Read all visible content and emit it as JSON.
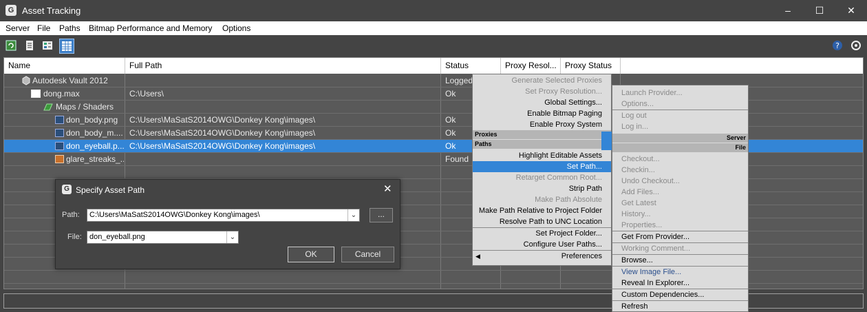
{
  "window": {
    "title": "Asset Tracking",
    "minimize": "–",
    "maximize": "☐",
    "close": "✕"
  },
  "menubar": [
    "Server",
    "File",
    "Paths",
    "Bitmap Performance and Memory",
    "Options"
  ],
  "toolbar": {
    "icons": [
      "refresh-icon",
      "list-view-icon",
      "detail-view-icon",
      "table-view-icon",
      "help-icon",
      "settings-icon"
    ]
  },
  "grid": {
    "headers": [
      "Name",
      "Full Path",
      "Status",
      "Proxy Resol...",
      "Proxy Status"
    ],
    "rows": [
      {
        "name": "Autodesk Vault 2012",
        "path": "",
        "status": "Logged"
      },
      {
        "name": "dong.max",
        "path": "C:\\Users\\",
        "status": "Ok"
      },
      {
        "name": "Maps / Shaders",
        "path": "",
        "status": ""
      },
      {
        "name": "don_body.png",
        "path": "C:\\Users\\MaSatS2014OWG\\Donkey Kong\\images\\",
        "status": "Ok"
      },
      {
        "name": "don_body_m....",
        "path": "C:\\Users\\MaSatS2014OWG\\Donkey Kong\\images\\",
        "status": "Ok"
      },
      {
        "name": "don_eyeball.p...",
        "path": "C:\\Users\\MaSatS2014OWG\\Donkey Kong\\images\\",
        "status": "Ok"
      },
      {
        "name": "glare_streaks_...",
        "path": "",
        "status": "Found"
      }
    ]
  },
  "context_menu_left": {
    "items": [
      {
        "label": "Generate Selected Proxies",
        "enabled": false
      },
      {
        "label": "Set Proxy Resolution...",
        "enabled": false
      },
      {
        "label": "Global Settings...",
        "enabled": true
      },
      {
        "label": "Enable Bitmap Paging",
        "enabled": true
      },
      {
        "label": "Enable Proxy System",
        "enabled": true
      },
      {
        "label": "Highlight Editable Assets",
        "enabled": true
      },
      {
        "label": "Set Path...",
        "enabled": true,
        "highlighted": true
      },
      {
        "label": "Retarget Common Root...",
        "enabled": false
      },
      {
        "label": "Strip Path",
        "enabled": true
      },
      {
        "label": "Make Path Absolute",
        "enabled": false
      },
      {
        "label": "Make Path Relative to Project Folder",
        "enabled": true
      },
      {
        "label": "Resolve Path to UNC Location",
        "enabled": true
      },
      {
        "label": "Set Project Folder...",
        "enabled": true
      },
      {
        "label": "Configure User Paths...",
        "enabled": true
      },
      {
        "label": "Preferences",
        "enabled": true
      }
    ],
    "section_proxies": "Proxies",
    "section_paths": "Paths"
  },
  "context_menu_right": {
    "items": [
      {
        "label": "Launch Provider...",
        "enabled": false
      },
      {
        "label": "Options...",
        "enabled": false
      },
      {
        "label": "Log out",
        "enabled": false
      },
      {
        "label": "Log in...",
        "enabled": false
      },
      {
        "label": "Checkout...",
        "enabled": false
      },
      {
        "label": "Checkin...",
        "enabled": false
      },
      {
        "label": "Undo Checkout...",
        "enabled": false
      },
      {
        "label": "Add Files...",
        "enabled": false
      },
      {
        "label": "Get Latest",
        "enabled": false
      },
      {
        "label": "History...",
        "enabled": false
      },
      {
        "label": "Properties...",
        "enabled": false
      },
      {
        "label": "Get From Provider...",
        "enabled": true
      },
      {
        "label": "Working Comment...",
        "enabled": false
      },
      {
        "label": "Browse...",
        "enabled": true
      },
      {
        "label": "View Image File...",
        "enabled": true
      },
      {
        "label": "Reveal In Explorer...",
        "enabled": true
      },
      {
        "label": "Custom Dependencies...",
        "enabled": true
      },
      {
        "label": "Refresh",
        "enabled": true
      }
    ],
    "section_server": "Server",
    "section_file": "File"
  },
  "dialog": {
    "title": "Specify Asset Path",
    "path_label": "Path:",
    "path_value": "C:\\Users\\MaSatS2014OWG\\Donkey Kong\\images\\",
    "browse_label": "...",
    "file_label": "File:",
    "file_value": "don_eyeball.png",
    "ok_label": "OK",
    "cancel_label": "Cancel"
  },
  "colors": {
    "background": "#444444",
    "selection": "#3385d6",
    "menu_bg": "#dcdcdc"
  }
}
